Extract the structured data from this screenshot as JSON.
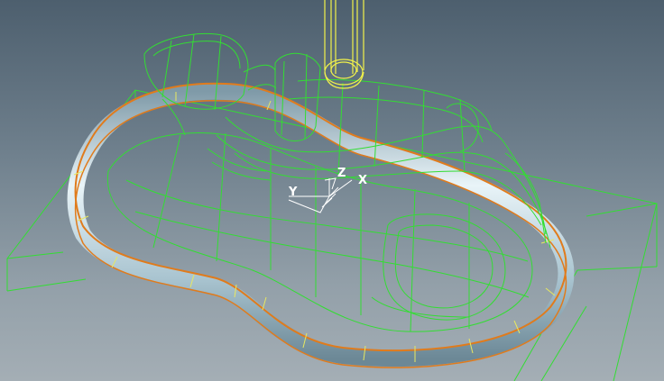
{
  "viewport": {
    "background_top": "#4d5f6e",
    "background_bottom": "#a4aeb5",
    "wireframe_color": "#33dd33",
    "tool_color": "#f2f24a",
    "surface_color": "#b9d3df",
    "edge_color": "#e07b1c"
  },
  "triad": {
    "x_label": "X",
    "y_label": "Y",
    "z_label": "Z"
  }
}
